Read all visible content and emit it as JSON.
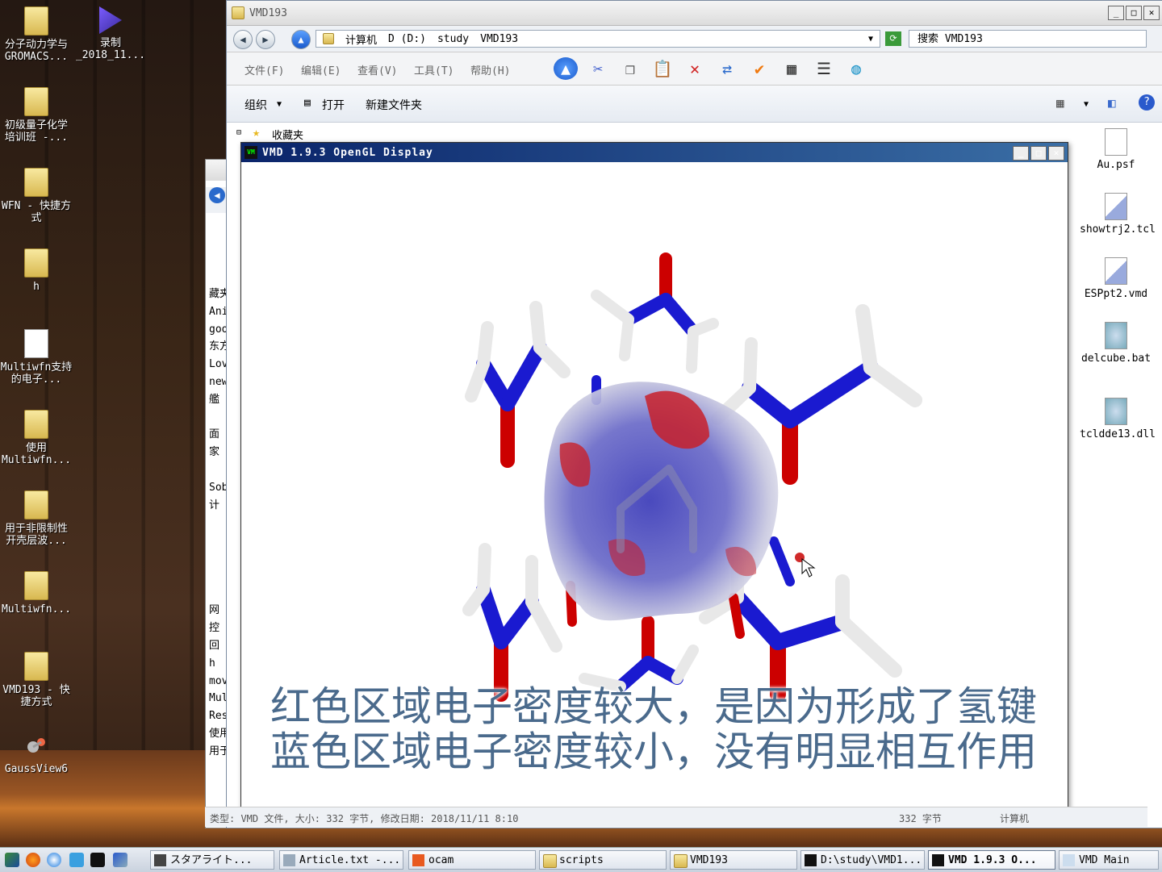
{
  "desktop": {
    "icons": [
      {
        "label": "分子动力学与GROMACS..."
      },
      {
        "label": "录制_2018_11..."
      },
      {
        "label": "初级量子化学培训班 -..."
      },
      {
        "label": "WFN - 快捷方式"
      },
      {
        "label": "h"
      },
      {
        "label": "Multiwfn支持的电子..."
      },
      {
        "label": "使用Multiwfn..."
      },
      {
        "label": "用于非限制性开壳层波..."
      },
      {
        "label": "Multiwfn..."
      },
      {
        "label": "VMD193 - 快捷方式"
      },
      {
        "label": "GaussView6"
      }
    ]
  },
  "explorer": {
    "title": "VMD193",
    "breadcrumb": [
      "计算机",
      "D (D:)",
      "study",
      "VMD193"
    ],
    "search_placeholder": "搜索 VMD193",
    "menu": [
      "文件(F)",
      "编辑(E)",
      "查看(V)",
      "工具(T)",
      "帮助(H)"
    ],
    "org": {
      "organize": "组织",
      "open": "打开",
      "new_folder": "新建文件夹"
    },
    "favorites": "收藏夹",
    "files": [
      "Au.psf",
      "showtrj2.tcl",
      "ESPpt2.vmd",
      "delcube.bat",
      "tcldde13.dll"
    ],
    "status": {
      "type": "类型: VMD 文件, 大小: 332 字节, 修改日期: 2018/11/11 8:10",
      "size": "332 字节",
      "location": "计算机"
    }
  },
  "back_explorer": {
    "rows": [
      "藏夹",
      "Ani",
      "goo",
      "东方",
      "Lov",
      "new",
      "艦",
      "",
      "面",
      "家",
      "",
      "Sob",
      "计",
      "",
      "",
      "",
      "",
      "",
      "网",
      "控",
      "回",
      "h",
      "move",
      "Mult",
      "Resea",
      "使用",
      "用于"
    ]
  },
  "vmd": {
    "title": "VMD 1.9.3 OpenGL Display",
    "logo": "VM"
  },
  "subtitle": {
    "line1": "红色区域电子密度较大，是因为形成了氢键",
    "line2": "蓝色区域电子密度较小，没有明显相互作用"
  },
  "taskbar": {
    "tasks": [
      "スタアライト...",
      "Article.txt -...",
      "ocam",
      "scripts",
      "VMD193",
      "D:\\study\\VMD1...",
      "VMD 1.9.3 O...",
      "VMD Main"
    ]
  },
  "colors": {
    "accent": "#0a246a",
    "red_region": "#c8202a",
    "blue_region": "#2a3aa8",
    "bond_teal": "#3a9a9a"
  }
}
